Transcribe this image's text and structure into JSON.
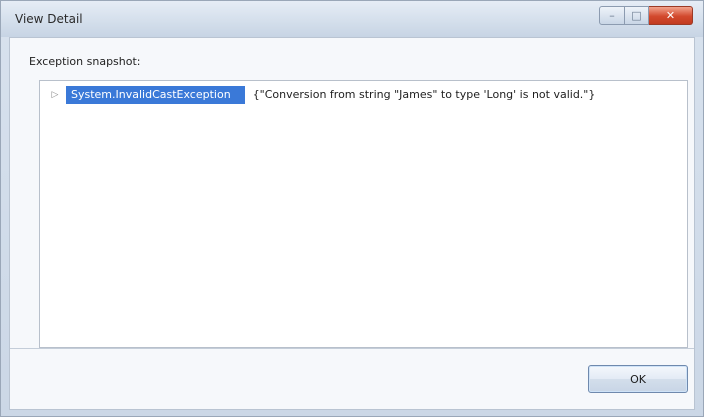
{
  "window": {
    "title": "View Detail",
    "controls": {
      "minimize_glyph": "–",
      "maximize_glyph": "□",
      "close_glyph": "✕"
    }
  },
  "content": {
    "label": "Exception snapshot:",
    "tree": {
      "expander_glyph": "▷",
      "node_name": "System.InvalidCastException",
      "node_value": "{\"Conversion from string \"James\" to type 'Long' is not valid.\"}"
    }
  },
  "buttons": {
    "ok_label": "OK"
  },
  "colors": {
    "selection": "#3a79d8",
    "close_button": "#d2492d"
  }
}
